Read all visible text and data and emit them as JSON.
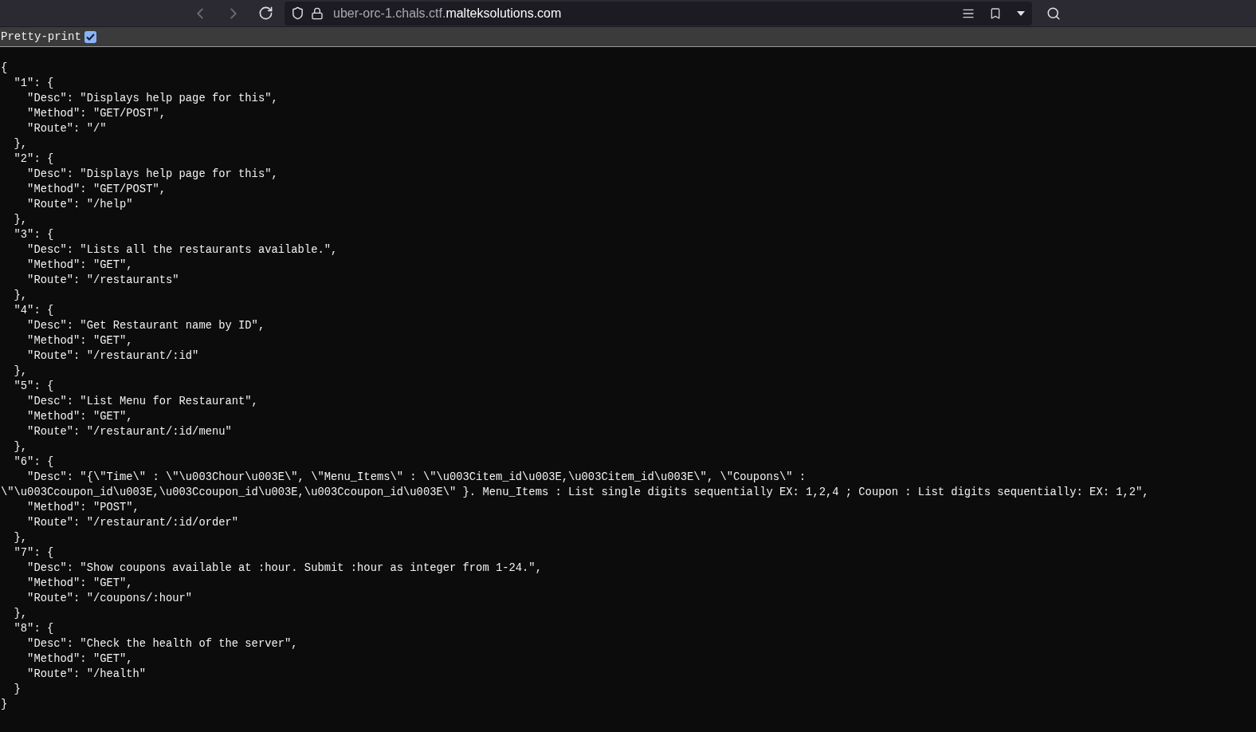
{
  "browser": {
    "url_host_prefix": "uber-orc-1.chals.ctf.",
    "url_domain": "malteksolutions.com"
  },
  "toolbar": {
    "pretty_print": {
      "label": "Pretty-print",
      "checked": true
    }
  },
  "json_lines": [
    "{",
    "  \"1\": {",
    "    \"Desc\": \"Displays help page for this\",",
    "    \"Method\": \"GET/POST\",",
    "    \"Route\": \"/\"",
    "  },",
    "  \"2\": {",
    "    \"Desc\": \"Displays help page for this\",",
    "    \"Method\": \"GET/POST\",",
    "    \"Route\": \"/help\"",
    "  },",
    "  \"3\": {",
    "    \"Desc\": \"Lists all the restaurants available.\",",
    "    \"Method\": \"GET\",",
    "    \"Route\": \"/restaurants\"",
    "  },",
    "  \"4\": {",
    "    \"Desc\": \"Get Restaurant name by ID\",",
    "    \"Method\": \"GET\",",
    "    \"Route\": \"/restaurant/:id\"",
    "  },",
    "  \"5\": {",
    "    \"Desc\": \"List Menu for Restaurant\",",
    "    \"Method\": \"GET\",",
    "    \"Route\": \"/restaurant/:id/menu\"",
    "  },",
    "  \"6\": {",
    "    \"Desc\": \"{\\\"Time\\\" : \\\"\\u003Chour\\u003E\\\", \\\"Menu_Items\\\" : \\\"\\u003Citem_id\\u003E,\\u003Citem_id\\u003E\\\", \\\"Coupons\\\" :",
    "\\\"\\u003Ccoupon_id\\u003E,\\u003Ccoupon_id\\u003E,\\u003Ccoupon_id\\u003E\\\" }. Menu_Items : List single digits sequentially EX: 1,2,4 ; Coupon : List digits sequentially: EX: 1,2\",",
    "    \"Method\": \"POST\",",
    "    \"Route\": \"/restaurant/:id/order\"",
    "  },",
    "  \"7\": {",
    "    \"Desc\": \"Show coupons available at :hour. Submit :hour as integer from 1-24.\",",
    "    \"Method\": \"GET\",",
    "    \"Route\": \"/coupons/:hour\"",
    "  },",
    "  \"8\": {",
    "    \"Desc\": \"Check the health of the server\",",
    "    \"Method\": \"GET\",",
    "    \"Route\": \"/health\"",
    "  }",
    "}"
  ]
}
